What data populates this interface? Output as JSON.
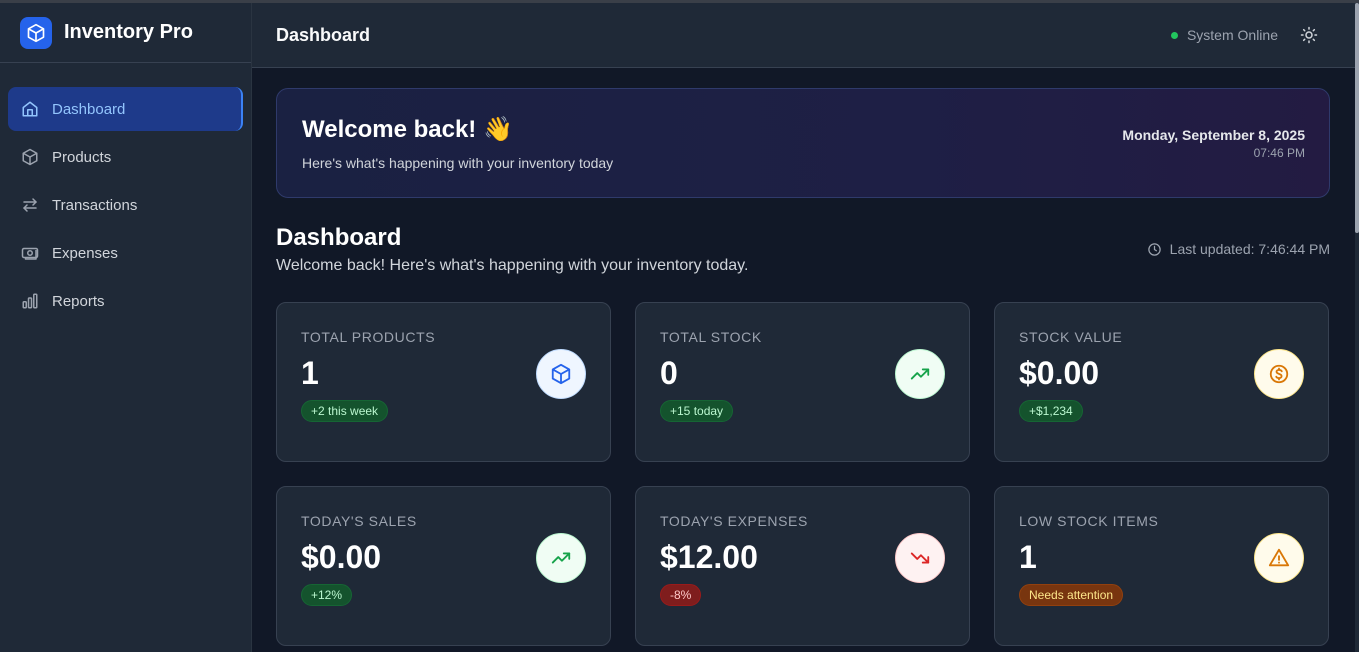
{
  "app": {
    "name": "Inventory Pro"
  },
  "sidebar": {
    "items": [
      {
        "label": "Dashboard",
        "icon": "home-icon",
        "active": true
      },
      {
        "label": "Products",
        "icon": "cube-icon",
        "active": false
      },
      {
        "label": "Transactions",
        "icon": "swap-arrows-icon",
        "active": false
      },
      {
        "label": "Expenses",
        "icon": "banknote-icon",
        "active": false
      },
      {
        "label": "Reports",
        "icon": "bar-chart-icon",
        "active": false
      }
    ]
  },
  "header": {
    "title": "Dashboard",
    "status": "System Online",
    "theme_icon": "sun-icon"
  },
  "welcome": {
    "title": "Welcome back! 👋",
    "subtitle": "Here's what's happening with your inventory today",
    "date": "Monday, September 8, 2025",
    "time": "07:46 PM"
  },
  "section": {
    "title": "Dashboard",
    "subtitle": "Welcome back! Here's what's happening with your inventory today.",
    "updated": "Last updated: 7:46:44 PM"
  },
  "cards": [
    {
      "label": "TOTAL PRODUCTS",
      "value": "1",
      "badge": "+2 this week",
      "badge_color": "green",
      "icon": "cube-icon",
      "icon_color": "#2563eb"
    },
    {
      "label": "TOTAL STOCK",
      "value": "0",
      "badge": "+15 today",
      "badge_color": "green",
      "icon": "trending-up-icon",
      "icon_color": "#16a34a"
    },
    {
      "label": "STOCK VALUE",
      "value": "$0.00",
      "badge": "+$1,234",
      "badge_color": "green",
      "icon": "dollar-circle-icon",
      "icon_color": "#d97706"
    },
    {
      "label": "TODAY'S SALES",
      "value": "$0.00",
      "badge": "+12%",
      "badge_color": "green",
      "icon": "trending-up-icon",
      "icon_color": "#16a34a"
    },
    {
      "label": "TODAY'S EXPENSES",
      "value": "$12.00",
      "badge": "-8%",
      "badge_color": "red",
      "icon": "trending-down-icon",
      "icon_color": "#dc2626"
    },
    {
      "label": "LOW STOCK ITEMS",
      "value": "1",
      "badge": "Needs attention",
      "badge_color": "amber",
      "icon": "warning-icon",
      "icon_color": "#d97706"
    }
  ]
}
